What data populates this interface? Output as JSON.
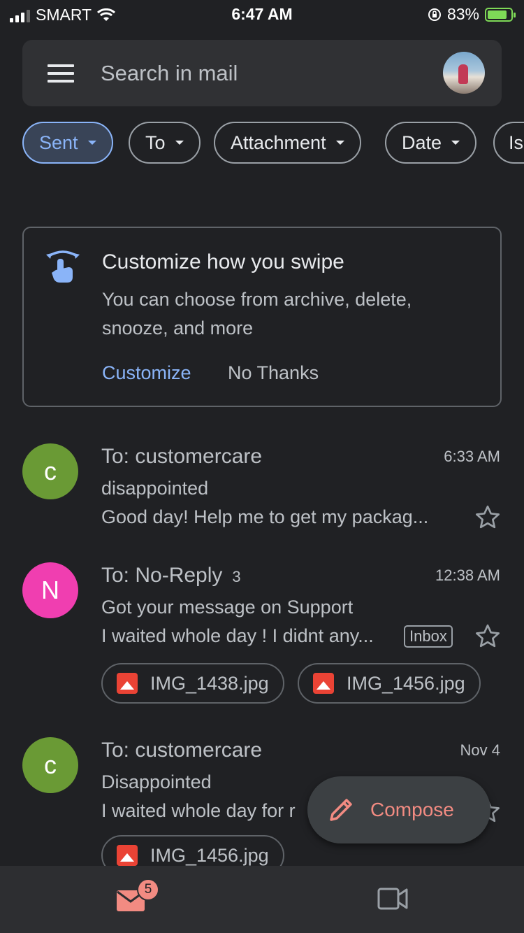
{
  "status": {
    "carrier": "SMART",
    "time": "6:47 AM",
    "battery": "83%",
    "battery_level": 0.83
  },
  "search": {
    "placeholder": "Search in mail"
  },
  "chips": [
    {
      "label": "Sent"
    },
    {
      "label": "To"
    },
    {
      "label": "Attachment"
    },
    {
      "label": "Date"
    },
    {
      "label": "Is"
    }
  ],
  "card": {
    "title": "Customize how you swipe",
    "description": "You can choose from archive, delete, snooze, and more",
    "primary": "Customize",
    "secondary": "No Thanks"
  },
  "emails": [
    {
      "initial": "c",
      "avatar_color": "#6a9a35",
      "to": "To: customercare",
      "count": "",
      "time": "6:33 AM",
      "subject": "disappointed",
      "snippet": "Good day! Help me to get my packag..."
    },
    {
      "initial": "N",
      "avatar_color": "#f03eb0",
      "to": "To: No-Reply",
      "count": "3",
      "time": "12:38 AM",
      "subject": "Got your message on Support",
      "snippet": "I waited whole day ! I didnt any...",
      "label": "Inbox",
      "attachments": [
        "IMG_1438.jpg",
        "IMG_1456.jpg"
      ]
    },
    {
      "initial": "c",
      "avatar_color": "#6a9a35",
      "to": "To: customercare",
      "count": "",
      "time": "Nov 4",
      "subject": "Disappointed",
      "snippet": "I waited whole day for r",
      "attachments": [
        "IMG_1456.jpg"
      ]
    }
  ],
  "compose": {
    "label": "Compose"
  },
  "bottom_nav": {
    "mail_badge": "5"
  },
  "colors": {
    "background": "#202124",
    "accent": "#8ab4f8",
    "compose": "#f28b82"
  }
}
